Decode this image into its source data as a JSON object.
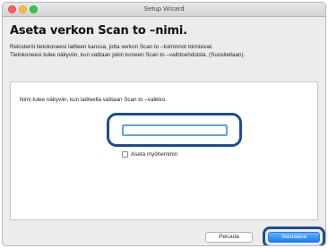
{
  "window": {
    "title": "Setup Wizard"
  },
  "heading": "Aseta verkon Scan to –nimi.",
  "description": {
    "line1": "Rekisteröi tietokoneesi laitteen kanssa, jotta verkon Scan to –toiminnot toimisivat.",
    "line2": "Tietokoneesi tulee näkyviin, kun valitaan jokin koneen Scan to –vaihtoehdoista. (Suositellaan)."
  },
  "panel": {
    "label": "Nimi tulee näkyviin, kun laitteella valitaan Scan to –valikko.",
    "name_input": {
      "value": "",
      "placeholder": ""
    },
    "later_checkbox": {
      "label": "Aseta myöhemmin",
      "checked": false
    }
  },
  "buttons": {
    "cancel": "Peruuta",
    "next": "Seuraava"
  }
}
